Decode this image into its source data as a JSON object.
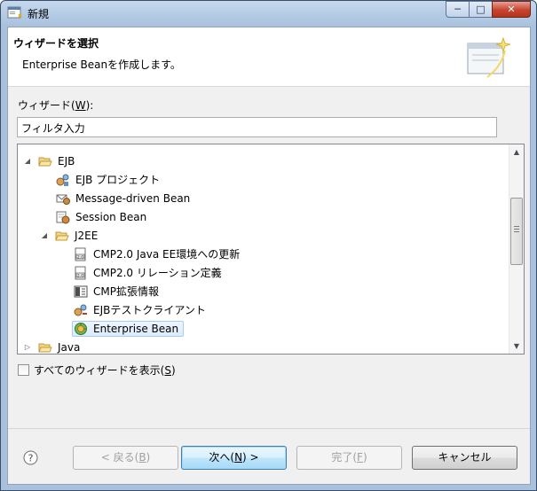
{
  "window": {
    "title": "新規",
    "controls": {
      "minimize": "─",
      "maximize": "□",
      "close": "✕"
    }
  },
  "banner": {
    "title": "ウィザードを選択",
    "description": "Enterprise Beanを作成します。",
    "graphic": "wizard-banner-icon"
  },
  "wizard_label": {
    "prefix": "ウィザード(",
    "mnemonic": "W",
    "suffix": "):"
  },
  "filter": {
    "value": "フィルタ入力"
  },
  "tree": {
    "items": [
      {
        "label": "EJB",
        "expanded": true,
        "icon": "folder-open-icon",
        "level": 0
      },
      {
        "label": "EJB プロジェクト",
        "icon": "ejb-project-icon",
        "level": 1
      },
      {
        "label": "Message-driven Bean",
        "icon": "message-driven-bean-icon",
        "level": 1
      },
      {
        "label": "Session Bean",
        "icon": "session-bean-icon",
        "level": 1
      },
      {
        "label": "J2EE",
        "expanded": true,
        "icon": "folder-open-icon",
        "level": 1
      },
      {
        "label": "CMP2.0 Java EE環境への更新",
        "icon": "cmp-update-icon",
        "level": 2
      },
      {
        "label": "CMP2.0 リレーション定義",
        "icon": "cmp-relation-icon",
        "level": 2
      },
      {
        "label": "CMP拡張情報",
        "icon": "cmp-extension-icon",
        "level": 2
      },
      {
        "label": "EJBテストクライアント",
        "icon": "ejb-test-client-icon",
        "level": 2
      },
      {
        "label": "Enterprise Bean",
        "icon": "enterprise-bean-icon",
        "level": 2,
        "selected": true
      },
      {
        "label": "Java",
        "expanded": false,
        "icon": "folder-icon",
        "level": 0
      }
    ]
  },
  "show_all": {
    "prefix": "すべてのウィザードを表示(",
    "mnemonic": "S",
    "suffix": ")",
    "checked": false
  },
  "buttons": {
    "back": {
      "prefix": "< 戻る(",
      "mnemonic": "B",
      "suffix": ")",
      "enabled": false
    },
    "next": {
      "prefix": "次へ(",
      "mnemonic": "N",
      "suffix": ") >",
      "enabled": true
    },
    "finish": {
      "prefix": "完了(",
      "mnemonic": "F",
      "suffix": ")",
      "enabled": false
    },
    "cancel": {
      "label": "キャンセル",
      "enabled": true
    }
  },
  "colors": {
    "selection": "#dcebfc",
    "titlebar": "#a8c2de",
    "dialog": "#f0f0f0"
  }
}
